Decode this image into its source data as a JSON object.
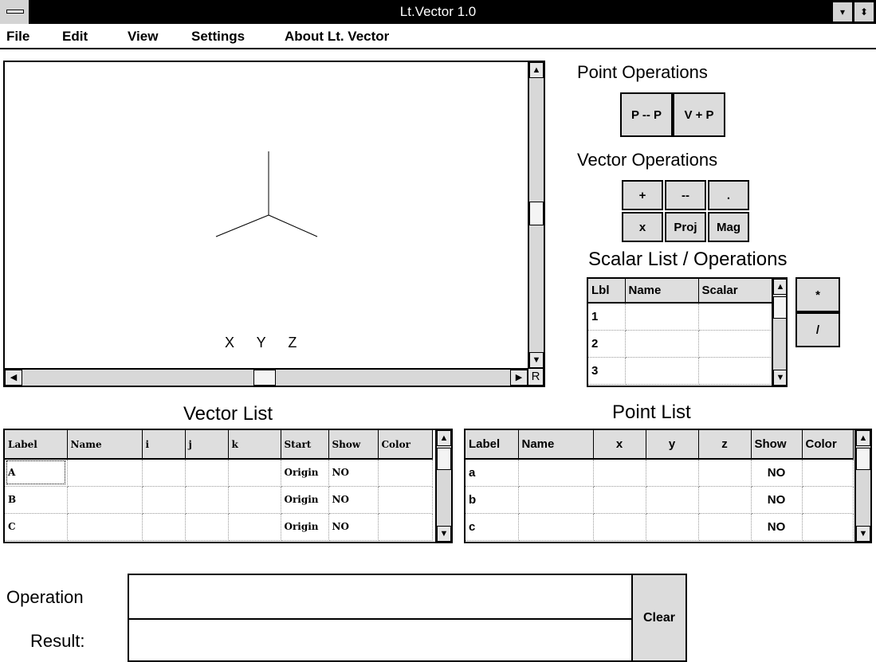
{
  "window": {
    "title": "Lt.Vector 1.0",
    "minimize_glyph": "▾",
    "restore_glyph": "⬍",
    "system_menu_icon": "system-menu-icon"
  },
  "menu": {
    "items": [
      {
        "label": "File"
      },
      {
        "label": "Edit"
      },
      {
        "label": "View"
      },
      {
        "label": "Settings"
      },
      {
        "label": "About Lt. Vector"
      }
    ]
  },
  "canvas": {
    "axis_legend": "X  Y  Z",
    "reset_label": "R",
    "scroll_up": "▲",
    "scroll_down": "▼",
    "scroll_left": "◀",
    "scroll_right": "▶"
  },
  "point_ops": {
    "heading": "Point Operations",
    "buttons": [
      "P -- P",
      "V + P"
    ]
  },
  "vector_ops": {
    "heading": "Vector Operations",
    "buttons": [
      "+",
      "--",
      ".",
      "x",
      "Proj",
      "Mag"
    ]
  },
  "scalar": {
    "heading": "Scalar List / Operations",
    "columns": [
      "Lbl",
      "Name",
      "Scalar"
    ],
    "rows": [
      [
        "1",
        "",
        ""
      ],
      [
        "2",
        "",
        ""
      ],
      [
        "3",
        "",
        ""
      ]
    ],
    "ops": [
      "*",
      "/"
    ]
  },
  "vector_list": {
    "heading": "Vector List",
    "columns": [
      "Label",
      "Name",
      "i",
      "j",
      "k",
      "Start",
      "Show",
      "Color"
    ],
    "rows": [
      [
        "A",
        "",
        "",
        "",
        "",
        "Origin",
        "NO",
        ""
      ],
      [
        "B",
        "",
        "",
        "",
        "",
        "Origin",
        "NO",
        ""
      ],
      [
        "C",
        "",
        "",
        "",
        "",
        "Origin",
        "NO",
        ""
      ]
    ]
  },
  "point_list": {
    "heading": "Point List",
    "columns": [
      "Label",
      "Name",
      "x",
      "y",
      "z",
      "Show",
      "Color"
    ],
    "rows": [
      [
        "a",
        "",
        "",
        "",
        "",
        "NO",
        ""
      ],
      [
        "b",
        "",
        "",
        "",
        "",
        "NO",
        ""
      ],
      [
        "c",
        "",
        "",
        "",
        "",
        "NO",
        ""
      ]
    ]
  },
  "bottom": {
    "operation_label": "Operation",
    "result_label": "Result:",
    "operation_value": "",
    "result_value": "",
    "clear_label": "Clear"
  },
  "colors": {
    "titlebar": "#000000",
    "button_face": "#dcdcdc",
    "background": "#ffffff"
  }
}
